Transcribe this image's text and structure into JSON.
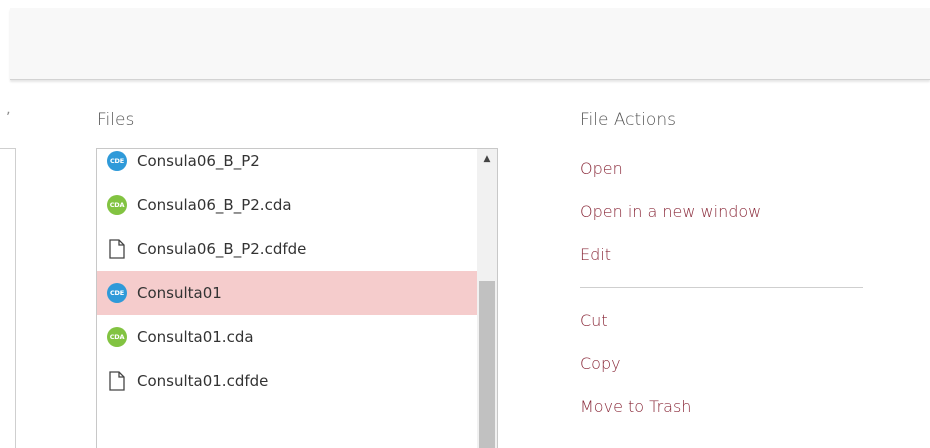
{
  "left_panel": {
    "glyph": "ʼ"
  },
  "files": {
    "heading": "Files",
    "items": [
      {
        "name": "Consula06_B_P2",
        "icon": "cde-icon",
        "badge": "CDE",
        "color": "#2f9ad9",
        "selected": false
      },
      {
        "name": "Consula06_B_P2.cda",
        "icon": "cda-icon",
        "badge": "CDA",
        "color": "#82c341",
        "selected": false
      },
      {
        "name": "Consula06_B_P2.cdfde",
        "icon": "file-icon",
        "badge": "",
        "color": "",
        "selected": false
      },
      {
        "name": "Consulta01",
        "icon": "cde-icon",
        "badge": "CDE",
        "color": "#2f9ad9",
        "selected": true
      },
      {
        "name": "Consulta01.cda",
        "icon": "cda-icon",
        "badge": "CDA",
        "color": "#82c341",
        "selected": false
      },
      {
        "name": "Consulta01.cdfde",
        "icon": "file-icon",
        "badge": "",
        "color": "",
        "selected": false
      }
    ]
  },
  "file_actions": {
    "heading": "File Actions",
    "group1": [
      "Open",
      "Open in a new window",
      "Edit"
    ],
    "group2": [
      "Cut",
      "Copy",
      "Move to Trash"
    ]
  },
  "colors": {
    "selected_row": "#f5cccc",
    "action_link": "#8a2a3a",
    "cde_badge": "#2f9ad9",
    "cda_badge": "#82c341"
  }
}
